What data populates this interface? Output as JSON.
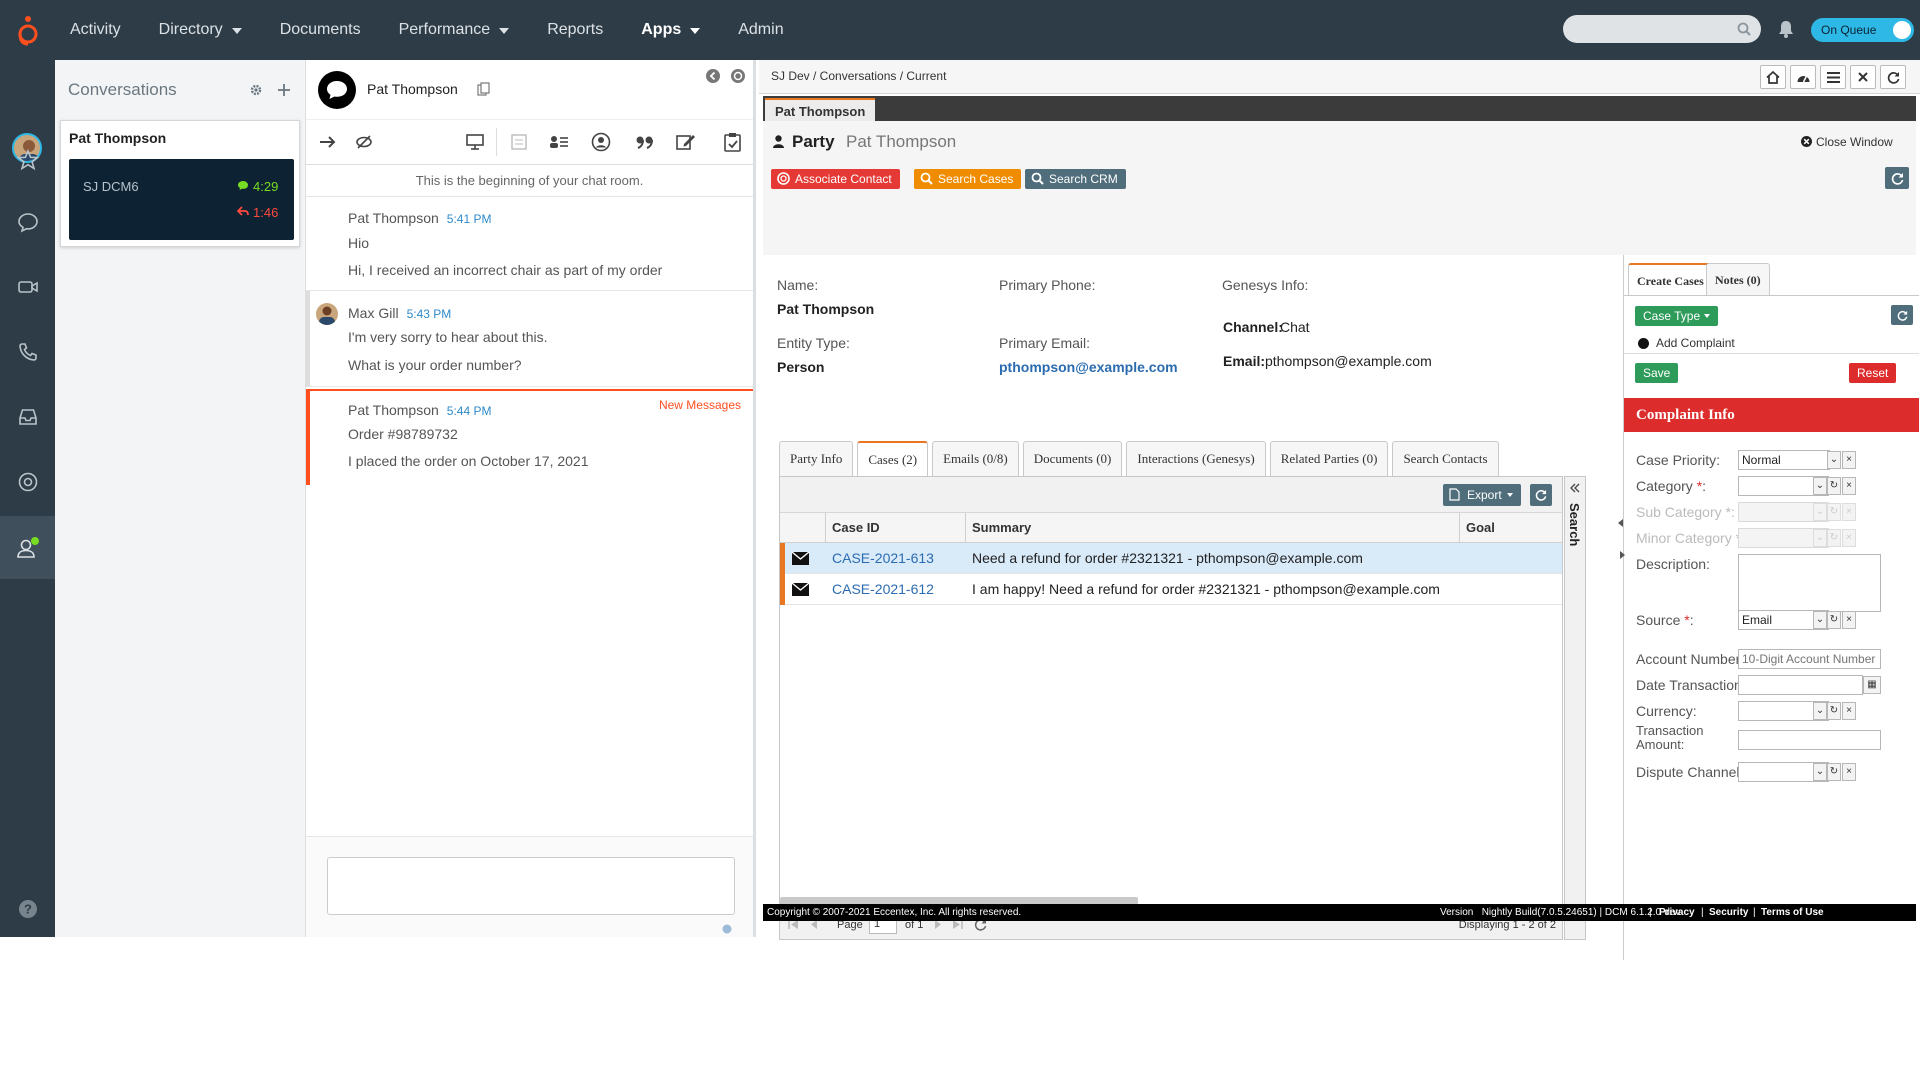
{
  "topnav": {
    "items": [
      {
        "label": "Activity",
        "dropdown": false
      },
      {
        "label": "Directory",
        "dropdown": true
      },
      {
        "label": "Documents",
        "dropdown": false
      },
      {
        "label": "Performance",
        "dropdown": true
      },
      {
        "label": "Reports",
        "dropdown": false
      },
      {
        "label": "Apps",
        "dropdown": true,
        "active": true
      },
      {
        "label": "Admin",
        "dropdown": false
      }
    ],
    "status_toggle": "On Queue"
  },
  "conversations": {
    "title": "Conversations",
    "card": {
      "name": "Pat Thompson",
      "queue": "SJ DCM6",
      "chat_time": "4:29",
      "wrap_time": "1:46"
    }
  },
  "chat": {
    "header_name": "Pat Thompson",
    "beginning_text": "This is the beginning of your chat room.",
    "messages": [
      {
        "author": "Pat Thompson",
        "time": "5:41 PM",
        "lines": [
          "Hio",
          "Hi, I received an incorrect chair as part of my order"
        ]
      },
      {
        "author": "Max Gill",
        "time": "5:43 PM",
        "lines": [
          "I'm very sorry to hear about this.",
          "What is your order number?"
        ]
      },
      {
        "author": "Pat Thompson",
        "time": "5:44 PM",
        "lines": [
          "Order #98789732",
          "I placed the order on October 17, 2021"
        ],
        "badge": "New Messages"
      }
    ]
  },
  "main": {
    "breadcrumb": "SJ Dev / Conversations / Current",
    "tab": "Pat Thompson",
    "party_label": "Party",
    "party_name": "Pat Thompson",
    "close_window": "Close Window",
    "buttons": {
      "associate": "Associate Contact",
      "search_cases": "Search Cases",
      "search_crm": "Search CRM"
    },
    "fields": {
      "name_label": "Name:",
      "name": "Pat Thompson",
      "entity_label": "Entity Type:",
      "entity": "Person",
      "phone_label": "Primary Phone:",
      "email_label": "Primary Email:",
      "email": "pthompson@example.com",
      "genesys_label": "Genesys Info:",
      "channel_label": "Channel:",
      "channel": "Chat",
      "gemail_label": "Email:",
      "gemail": "pthompson@example.com"
    },
    "tabs": [
      "Party Info",
      "Cases (2)",
      "Emails (0/8)",
      "Documents (0)",
      "Interactions (Genesys)",
      "Related Parties (0)",
      "Search Contacts"
    ],
    "grid": {
      "export": "Export",
      "columns": [
        "Case ID",
        "Summary",
        "Goal"
      ],
      "rows": [
        {
          "case_id": "CASE-2021-613",
          "summary": "Need a refund for order #2321321 - pthompson@example.com",
          "goal": ""
        },
        {
          "case_id": "CASE-2021-612",
          "summary": "I am happy! Need a refund for order #2321321 - pthompson@example.com",
          "goal": ""
        }
      ],
      "page_label": "Page",
      "page": "1",
      "of_label": "of 1",
      "displaying": "Displaying 1 - 2 of 2",
      "search_strip": "Search"
    },
    "footer": {
      "copyright": "Copyright © 2007-2021 Eccentex, Inc. All rights reserved.",
      "version": "Version   Nightly Build(7.0.5.24651) | DCM 6.1.2.0-dev",
      "privacy": "Privacy",
      "security": "Security",
      "terms": "Terms of Use"
    }
  },
  "right": {
    "tabs": [
      "Create Cases",
      "Notes (0)"
    ],
    "case_type": "Case Type",
    "add_complaint": "Add Complaint",
    "save": "Save",
    "reset": "Reset",
    "section": "Complaint Info",
    "form": {
      "case_priority": {
        "label": "Case Priority:",
        "value": "Normal"
      },
      "category": {
        "label": "Category"
      },
      "sub_category": {
        "label": "Sub Category"
      },
      "minor_category": {
        "label": "Minor Category"
      },
      "description": {
        "label": "Description:"
      },
      "source": {
        "label": "Source",
        "value": "Email"
      },
      "account_number": {
        "label": "Account Number:",
        "placeholder": "10-Digit Account Number"
      },
      "date_transaction": {
        "label": "Date Transaction:"
      },
      "currency": {
        "label": "Currency:"
      },
      "transaction_amount": {
        "label_1": "Transaction",
        "label_2": "Amount:"
      },
      "dispute_channel": {
        "label": "Dispute Channel:"
      }
    }
  }
}
